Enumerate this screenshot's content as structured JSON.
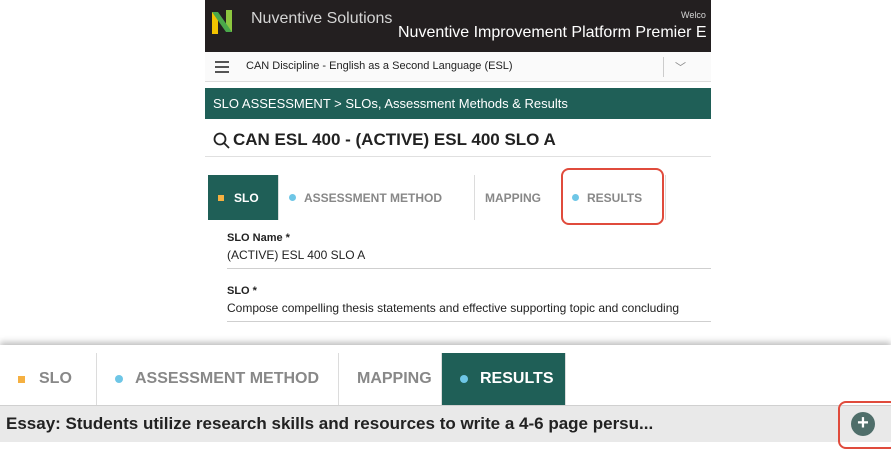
{
  "header": {
    "brand": "Nuventive Solutions",
    "platform_title": "Nuventive Improvement Platform Premier E",
    "welcome": "Welco"
  },
  "unit_selector": {
    "value": "CAN Discipline - English as a Second Language (ESL)"
  },
  "breadcrumb": {
    "text": "SLO ASSESSMENT > SLOs, Assessment Methods & Results"
  },
  "page_title": "CAN ESL 400 -  (ACTIVE) ESL 400 SLO A",
  "tabs": [
    {
      "label": "SLO"
    },
    {
      "label": "ASSESSMENT METHOD"
    },
    {
      "label": "MAPPING"
    },
    {
      "label": "RESULTS"
    }
  ],
  "form": {
    "slo_name_label": "SLO Name *",
    "slo_name_value": "(ACTIVE) ESL 400 SLO A",
    "slo_label": "SLO *",
    "slo_value": "Compose compelling thesis statements and effective supporting topic and concluding"
  },
  "assessment_method": {
    "title": "Essay: Students utilize research skills and resources to write a 4-6 page persu..."
  },
  "colors": {
    "brand_dark": "#231f20",
    "accent_teal": "#1f5f57",
    "highlight_red": "#e04b3c",
    "slo_marker": "#f5b041",
    "tab_marker": "#6ec6e6"
  }
}
